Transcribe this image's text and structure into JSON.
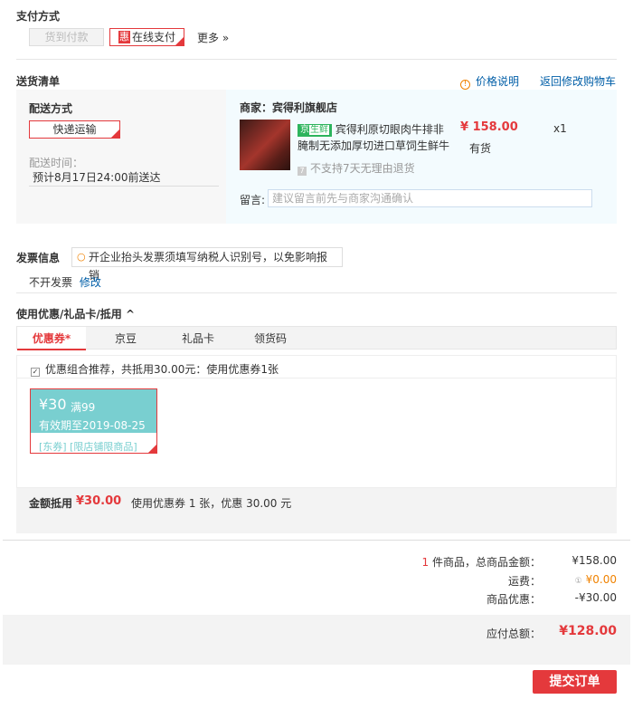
{
  "payment": {
    "title": "支付方式",
    "cod_label": "货到付款",
    "online_badge": "惠",
    "online_label": "在线支付",
    "more_label": "更多 »"
  },
  "shipping": {
    "title": "送货清单",
    "price_note": "价格说明",
    "back_cart": "返回修改购物车",
    "method_title": "配送方式",
    "method_value": "快递运输",
    "time_label": "配送时间：",
    "time_value": "预计8月17日24:00前送达",
    "shop_label": "商家：宾得利旗舰店",
    "fresh_tag_a": "京",
    "fresh_tag_b": "生鲜",
    "product_name_line1": "宾得利原切眼肉牛排非",
    "product_name_line2": "腌制无添加厚切进口草饲生鲜牛",
    "price": "¥ 158.00",
    "stock": "有货",
    "qty": "x1",
    "no_return": "不支持7天无理由退货",
    "note_label": "留言:",
    "note_placeholder": "建议留言前先与商家沟通确认"
  },
  "invoice": {
    "title": "发票信息",
    "tip": "开企业抬头发票须填写纳税人识别号，以免影响报销",
    "status": "不开发票",
    "edit": "修改"
  },
  "discount": {
    "title": "使用优惠/礼品卡/抵用 ^",
    "tabs": [
      "优惠券*",
      "京豆",
      "礼品卡",
      "领货码"
    ],
    "recommend": "优惠组合推荐，共抵用30.00元：使用优惠券1张",
    "coupon": {
      "amount": "¥30",
      "threshold": "满99",
      "expiry": "有效期至2019-08-25",
      "scope": "[东券] [限店铺限商品]"
    },
    "deduct_label": "金额抵用",
    "deduct_value": "¥30.00",
    "deduct_desc": "使用优惠券 1 张，优惠 30.00 元"
  },
  "summary": {
    "count": "1",
    "count_suffix": "件商品，总商品金额：",
    "goods_total": "¥158.00",
    "freight_label": "运费：",
    "freight_value": "¥0.00",
    "promo_label": "商品优惠：",
    "promo_value": "-¥30.00",
    "payable_label": "应付总额：",
    "payable_value": "¥128.00",
    "submit": "提交订单"
  },
  "colors": {
    "accent": "#e4393c",
    "link": "#005ea7",
    "coupon": "#79cfd0",
    "freight": "#f08200"
  }
}
